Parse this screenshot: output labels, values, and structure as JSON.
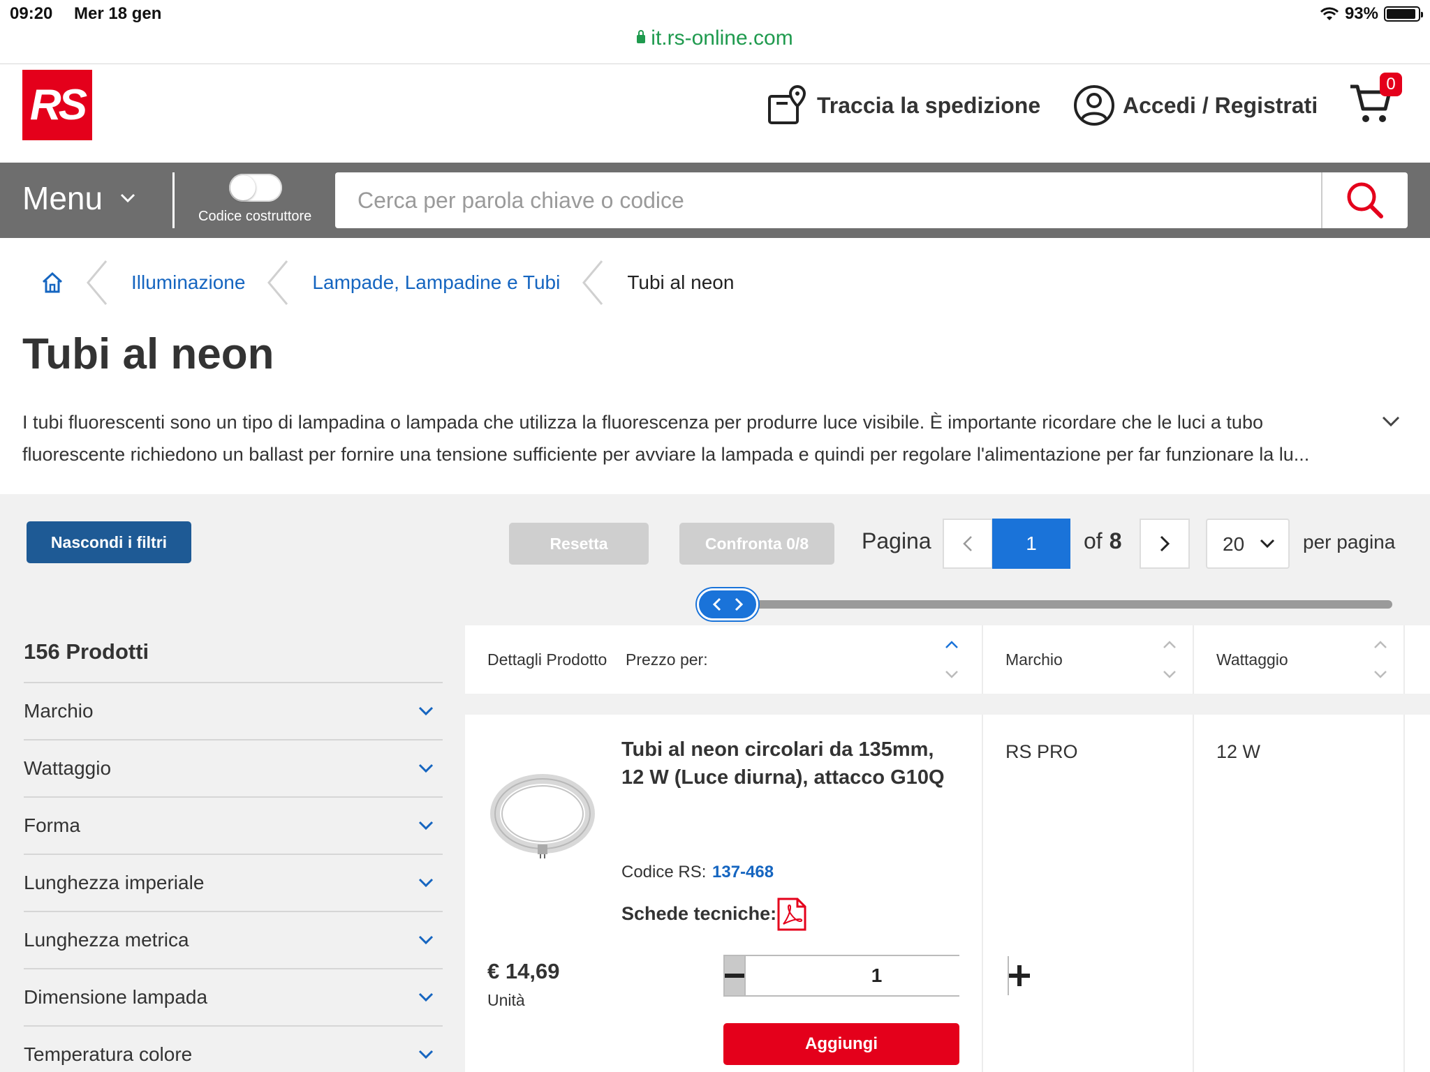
{
  "status_bar": {
    "time": "09:20",
    "date": "Mer 18 gen",
    "battery": "93%",
    "battery_level": 0.93
  },
  "browser": {
    "url": "it.rs-online.com"
  },
  "header": {
    "logo": "RS",
    "track_label": "Traccia la spedizione",
    "login_label": "Accedi / Registrati",
    "cart_count": "0"
  },
  "nav": {
    "menu_label": "Menu",
    "toggle_label": "Codice costruttore",
    "search_placeholder": "Cerca per parola chiave o codice"
  },
  "breadcrumb": {
    "items": [
      "Illuminazione",
      "Lampade, Lampadine e Tubi"
    ],
    "current": "Tubi al neon"
  },
  "page": {
    "title": "Tubi al neon",
    "description": "I tubi fluorescenti sono un tipo di lampadina o lampada che utilizza la fluorescenza per produrre luce visibile. È importante ricordare che le luci a tubo fluorescente richiedono un ballast per fornire una tensione sufficiente per avviare la lampada e quindi per regolare l'alimentazione per far funzionare la lu..."
  },
  "toolbar": {
    "hide_filters": "Nascondi i filtri",
    "reset": "Resetta",
    "compare": "Confronta 0/8",
    "page_label": "Pagina",
    "current_page": "1",
    "of_label": "of",
    "total_pages": "8",
    "per_page_value": "20",
    "per_page_label": "per pagina"
  },
  "filters": {
    "product_count": "156 Prodotti",
    "items": [
      "Marchio",
      "Wattaggio",
      "Forma",
      "Lunghezza imperiale",
      "Lunghezza metrica",
      "Dimensione lampada",
      "Temperatura colore"
    ]
  },
  "table": {
    "headers": {
      "details": "Dettagli Prodotto",
      "price_per": "Prezzo per:",
      "brand": "Marchio",
      "wattage": "Wattaggio"
    },
    "rows": [
      {
        "title": "Tubi al neon circolari da 135mm, 12 W (Luce diurna), attacco G10Q",
        "rs_code_label": "Codice RS:",
        "rs_code": "137-468",
        "datasheet_label": "Schede tecniche:",
        "price": "€ 14,69",
        "unit": "Unità",
        "quantity": "1",
        "add_label": "Aggiungi",
        "brand": "RS PRO",
        "wattage": "12 W"
      }
    ]
  },
  "colors": {
    "brand_red": "#e4001b",
    "link_blue": "#1565c0",
    "primary_blue": "#1a73d9",
    "dark_blue": "#1e5a95"
  }
}
